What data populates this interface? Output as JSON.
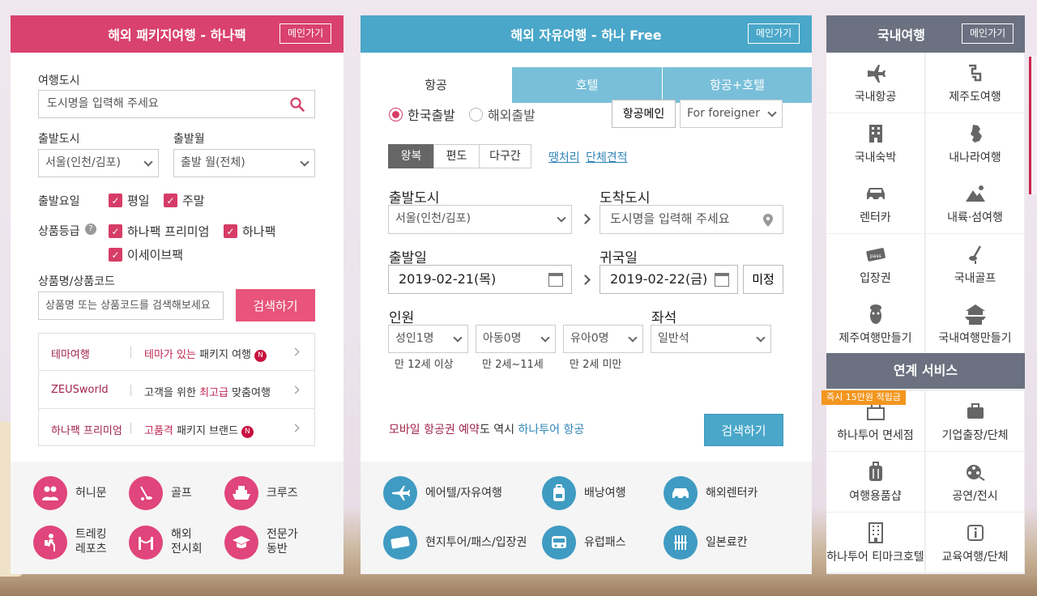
{
  "package": {
    "title": "해외 패키지여행 - 하나팩",
    "main_btn": "메인가기",
    "city_label": "여행도시",
    "city_placeholder": "도시명을 입력해 주세요",
    "depart_city_label": "출발도시",
    "depart_city_value": "서울(인천/김포)",
    "depart_month_label": "출발월",
    "depart_month_value": "출발 월(전체)",
    "day_label": "출발요일",
    "day_options": [
      "평일",
      "주말"
    ],
    "grade_label": "상품등급",
    "grade_options": [
      "하나팩 프리미엄",
      "하나팩",
      "이세이브팩"
    ],
    "product_label": "상품명/상품코드",
    "product_placeholder": "상품명 또는 상품코드를 검색해보세요",
    "search_btn": "검색하기",
    "links": [
      {
        "key": "테마여행",
        "pre": "",
        "hl": "테마가 있는",
        "post": " 패키지 여행",
        "badge": "N"
      },
      {
        "key": "ZEUSworld",
        "pre": "고객을 위한 ",
        "hl": "최고급",
        "post": " 맞춤여행",
        "badge": ""
      },
      {
        "key": "하나팩 프리미엄",
        "pre": "",
        "hl": "고품격",
        "post": " 패키지 브랜드",
        "badge": "N"
      }
    ],
    "categories": [
      "허니문",
      "골프",
      "크루즈",
      "트레킹\n레포츠",
      "해외\n전시회",
      "전문가\n동반"
    ]
  },
  "free": {
    "title": "해외 자유여행 - 하나 Free",
    "main_btn": "메인가기",
    "tabs": [
      "항공",
      "호텔",
      "항공+호텔"
    ],
    "radio_korea": "한국출발",
    "radio_abroad": "해외출발",
    "air_main_btn": "항공메인",
    "foreigner": "For foreigner",
    "trip_types": [
      "왕복",
      "편도",
      "다구간"
    ],
    "link_tent": "땡처리",
    "link_group": "단체견적",
    "depart_label": "출발도시",
    "depart_value": "서울(인천/김포)",
    "arrive_label": "도착도시",
    "arrive_placeholder": "도시명을 입력해 주세요",
    "date_depart_label": "출발일",
    "date_depart": "2019-02-21(목)",
    "date_return_label": "귀국일",
    "date_return": "2019-02-22(금)",
    "undecided": "미정",
    "pax_label": "인원",
    "seat_label": "좌석",
    "adult": "성인1명",
    "child": "아동0명",
    "infant": "유아0명",
    "seat": "일반석",
    "adult_sub": "만 12세 이상",
    "child_sub": "만 2세~11세",
    "infant_sub": "만 2세 미만",
    "promo_a": "모바일 항공권 예약",
    "promo_b": "도 역시 ",
    "promo_c": "하나투어 항공",
    "search_btn": "검색하기",
    "categories": [
      "에어텔/자유여행",
      "배낭여행",
      "해외렌터카",
      "현지투어/패스/입장권",
      "유럽패스",
      "일본료칸"
    ]
  },
  "domestic": {
    "title": "국내여행",
    "main_btn": "메인가기",
    "items": [
      "국내항공",
      "제주도여행",
      "국내숙박",
      "내나라여행",
      "렌터카",
      "내륙·섬여행",
      "입장권",
      "국내골프",
      "제주여행만들기",
      "국내여행만들기"
    ],
    "services_title": "연계 서비스",
    "promo_badge": "즉시 15만원 적립금",
    "services": [
      "하나투어 면세점",
      "기업출장/단체",
      "여행용품샵",
      "공연/전시",
      "하나투어 티마크호텔",
      "교육여행/단체"
    ]
  },
  "colors": {
    "pink": "#d9416e",
    "blue": "#4aa7c9",
    "gray_header": "#6b7180"
  }
}
